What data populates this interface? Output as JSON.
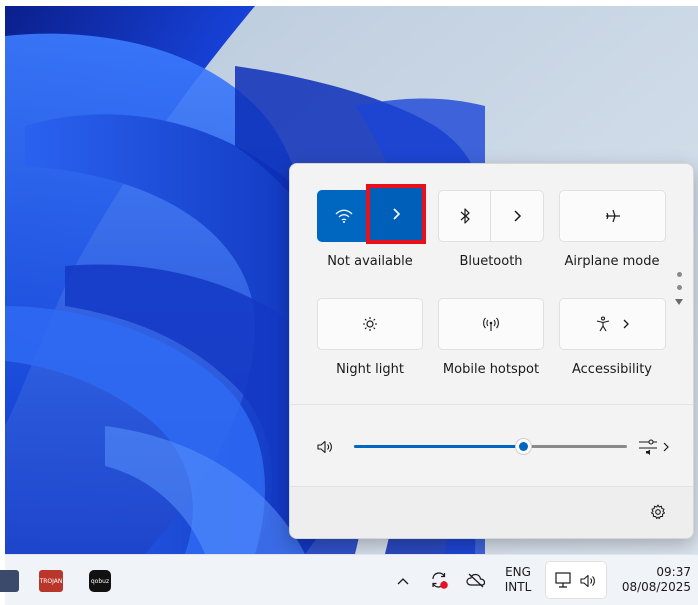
{
  "quick_settings": {
    "tiles": [
      {
        "id": "wifi",
        "label": "Not available",
        "icon": "wifi-icon",
        "state": "on",
        "has_chevron": true
      },
      {
        "id": "bluetooth",
        "label": "Bluetooth",
        "icon": "bluetooth-icon",
        "state": "off",
        "has_chevron": true
      },
      {
        "id": "airplane",
        "label": "Airplane mode",
        "icon": "airplane-icon",
        "state": "off",
        "has_chevron": false
      },
      {
        "id": "night-light",
        "label": "Night light",
        "icon": "brightness-icon",
        "state": "off",
        "has_chevron": false
      },
      {
        "id": "hotspot",
        "label": "Mobile hotspot",
        "icon": "hotspot-icon",
        "state": "off",
        "has_chevron": false
      },
      {
        "id": "accessibility",
        "label": "Accessibility",
        "icon": "accessibility-icon",
        "state": "off",
        "has_chevron": true
      }
    ],
    "volume": {
      "level": 0.62,
      "icon": "speaker-icon",
      "mixer_icon": "audio-mixer-icon"
    },
    "footer": {
      "settings_icon": "gear-icon"
    },
    "accent_color": "#0067c0",
    "highlight_color": "#e8101b"
  },
  "taskbar": {
    "apps": [
      {
        "name": "app-partial",
        "color": "#3b4a6b"
      },
      {
        "name": "trojan-app",
        "text": "TROJAN",
        "color": "#b8372a"
      },
      {
        "name": "qobuz-app",
        "text": "qobuz",
        "color": "#111111"
      }
    ],
    "tray": {
      "language_line1": "ENG",
      "language_line2": "INTL",
      "time": "09:37",
      "date": "08/08/2025"
    }
  }
}
